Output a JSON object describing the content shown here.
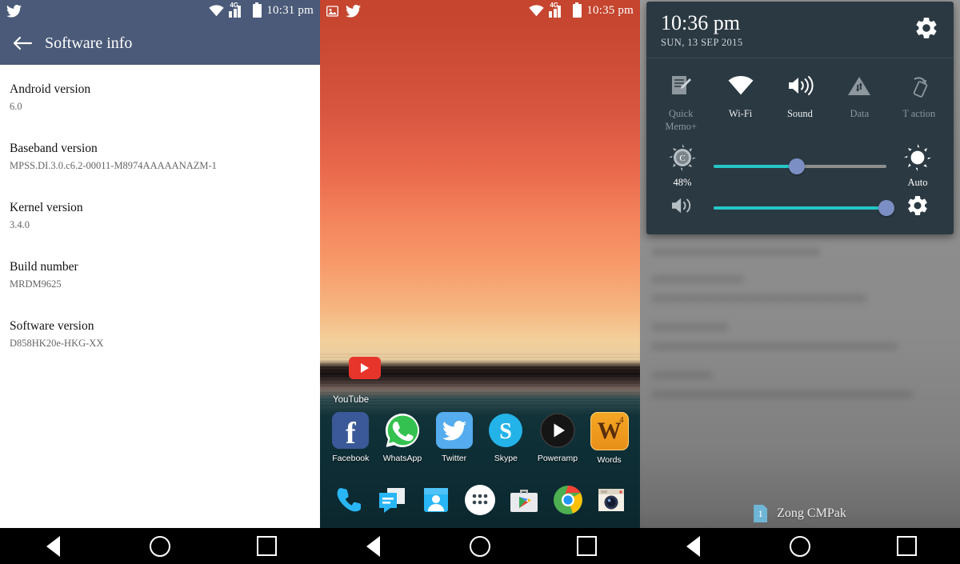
{
  "left_panel": {
    "status_bar": {
      "time": "10:31 pm",
      "icons": [
        "twitter-icon",
        "wifi-icon",
        "signal-4g-icon",
        "battery-icon"
      ],
      "network": "4G",
      "background_color": "#4a5a78"
    },
    "appbar": {
      "back_icon": "arrow-left-icon",
      "title": "Software info"
    },
    "items": [
      {
        "key": "Android version",
        "value": "6.0"
      },
      {
        "key": "Baseband version",
        "value": "MPSS.DI.3.0.c6.2-00011-M8974AAAAANAZM-1"
      },
      {
        "key": "Kernel version",
        "value": "3.4.0"
      },
      {
        "key": "Build number",
        "value": "MRDM9625"
      },
      {
        "key": "Software version",
        "value": "D858HK20e-HKG-XX"
      }
    ]
  },
  "middle_panel": {
    "status_bar": {
      "time": "10:35 pm",
      "icons": [
        "screenshot-icon",
        "twitter-icon",
        "wifi-icon",
        "signal-4g-icon",
        "battery-icon"
      ],
      "network": "4G"
    },
    "widget": {
      "label": "YouTube",
      "icon": "youtube-icon"
    },
    "apps": [
      {
        "label": "Facebook",
        "icon": "facebook-icon"
      },
      {
        "label": "WhatsApp",
        "icon": "whatsapp-icon"
      },
      {
        "label": "Twitter",
        "icon": "twitter-icon"
      },
      {
        "label": "Skype",
        "icon": "skype-icon"
      },
      {
        "label": "Poweramp",
        "icon": "poweramp-icon"
      },
      {
        "label": "Words",
        "icon": "words-with-friends-icon",
        "badge": "4"
      }
    ],
    "dock": [
      {
        "icon": "phone-icon",
        "label": "Phone"
      },
      {
        "icon": "messaging-icon",
        "label": "Messaging"
      },
      {
        "icon": "contacts-icon",
        "label": "Contacts"
      },
      {
        "icon": "app-drawer-icon",
        "label": "Apps"
      },
      {
        "icon": "play-store-icon",
        "label": "Play Store"
      },
      {
        "icon": "chrome-icon",
        "label": "Chrome"
      },
      {
        "icon": "camera-icon",
        "label": "Camera"
      }
    ]
  },
  "right_panel": {
    "shade": {
      "clock": "10:36 pm",
      "date": "SUN, 13 SEP 2015",
      "settings_icon": "gear-icon",
      "toggles": [
        {
          "label": "Quick Memo+",
          "icon": "quick-memo-icon",
          "state": "off"
        },
        {
          "label": "Wi-Fi",
          "icon": "wifi-icon",
          "state": "on"
        },
        {
          "label": "Sound",
          "icon": "sound-icon",
          "state": "on"
        },
        {
          "label": "Data",
          "icon": "mobile-data-icon",
          "state": "off"
        },
        {
          "label": "T action",
          "icon": "t-action-icon",
          "state": "off"
        }
      ],
      "brightness": {
        "icon": "brightness-icon",
        "value_label": "48%",
        "percent": 48,
        "auto_label": "Auto",
        "auto_icon": "auto-brightness-icon",
        "track_color": "#25c6c6",
        "knob_color": "#7b8fc4"
      },
      "volume": {
        "icon": "volume-icon",
        "percent": 100,
        "settings_icon": "gear-icon",
        "track_color": "#25c6c6",
        "knob_color": "#7b8fc4"
      },
      "background_color": "#2b3942"
    },
    "carrier": {
      "sim_number": "1",
      "name": "Zong CMPak"
    }
  },
  "navbar": {
    "back": "back-triangle-icon",
    "home": "home-circle-icon",
    "recents": "recents-square-icon"
  }
}
